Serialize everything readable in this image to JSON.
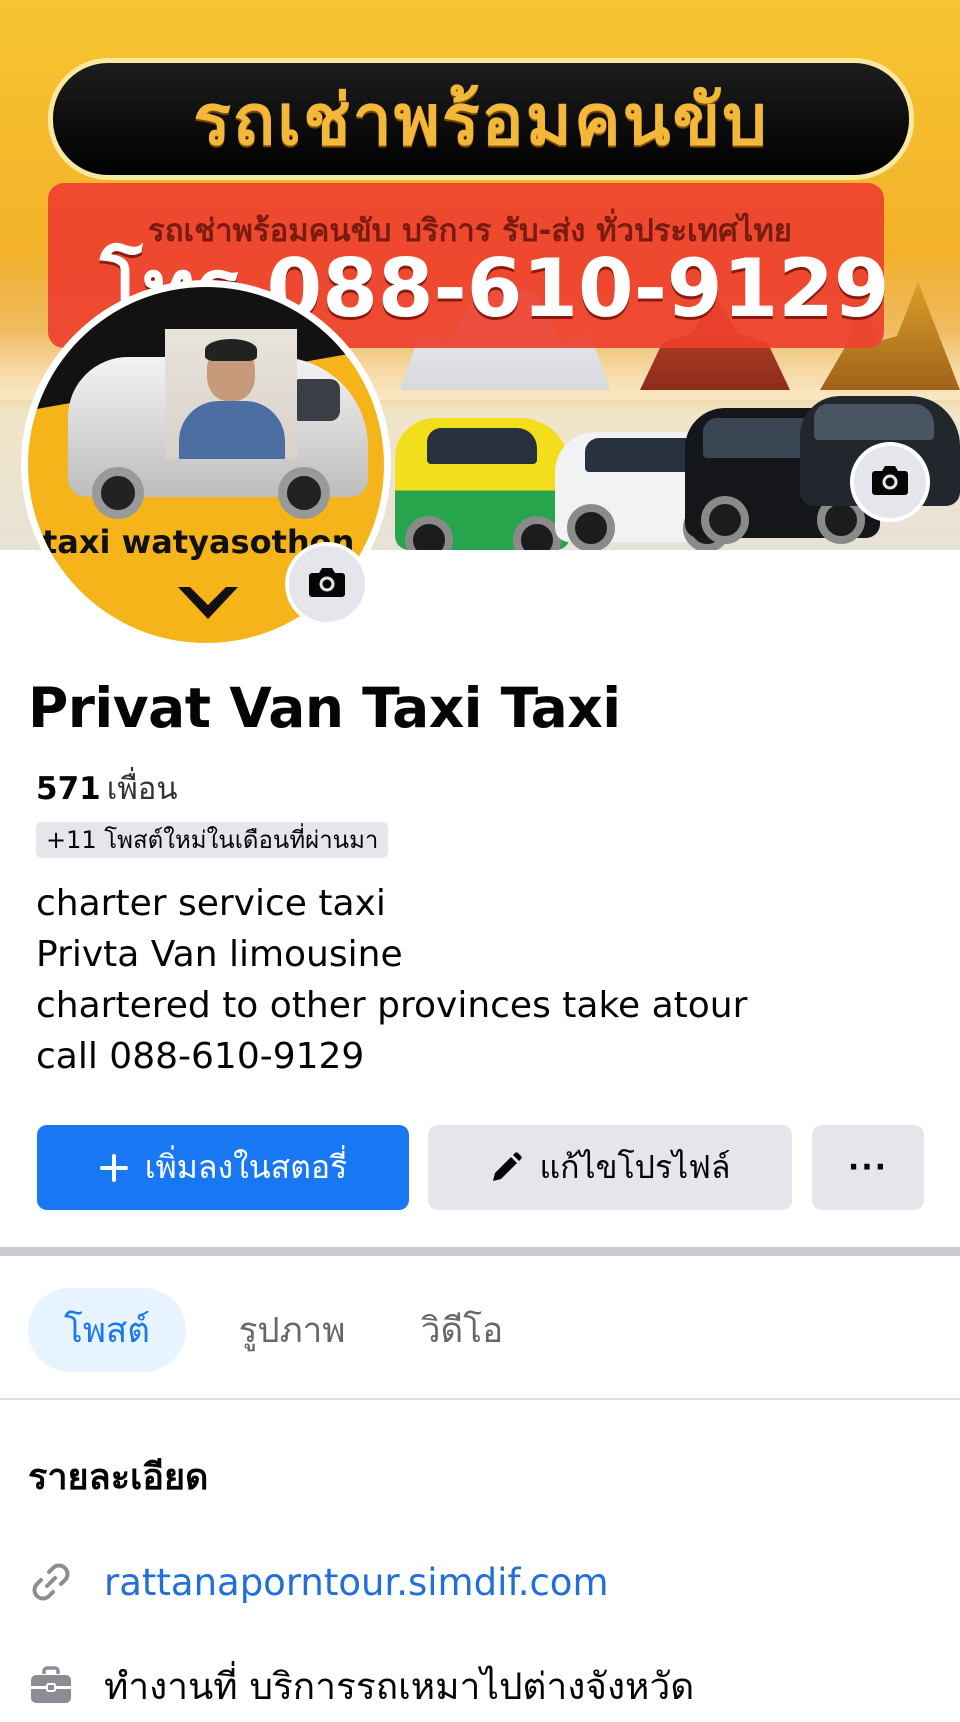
{
  "cover": {
    "title": "รถเช่าพร้อมคนขับ",
    "subtitle": "รถเช่าพร้อมคนขับ บริการ รับ-ส่ง ทั่วประเทศไทย",
    "phone_banner": "โทร 088-610-9129",
    "camera_icon": "camera-icon"
  },
  "avatar": {
    "logo_text": "taxi watyasothon ontour",
    "camera_icon": "camera-icon"
  },
  "profile": {
    "name": "Privat Van Taxi Taxi",
    "friends_count": "571",
    "friends_label": "เพื่อน",
    "new_posts_badge": "+11 โพสต์ใหม่ในเดือนที่ผ่านมา",
    "bio": [
      "charter service taxi",
      "Privta Van limousine",
      "chartered to other provinces take atour",
      "call 088-610-9129"
    ]
  },
  "actions": {
    "add_story": "เพิ่มลงในสตอรี่",
    "edit_profile": "แก้ไขโปรไฟล์",
    "more": "···"
  },
  "tabs": [
    {
      "label": "โพสต์",
      "active": true
    },
    {
      "label": "รูปภาพ",
      "active": false
    },
    {
      "label": "วิดีโอ",
      "active": false
    }
  ],
  "details": {
    "title": "รายละเอียด",
    "website": "rattanaporntour.simdif.com",
    "work": "ทำงานที่ บริการรถเหมาไปต่างจังหวัด"
  },
  "colors": {
    "primary": "#1877f2",
    "link": "#216fdb",
    "secondary_button": "#e4e6eb",
    "active_tab_bg": "#e7f3ff"
  }
}
